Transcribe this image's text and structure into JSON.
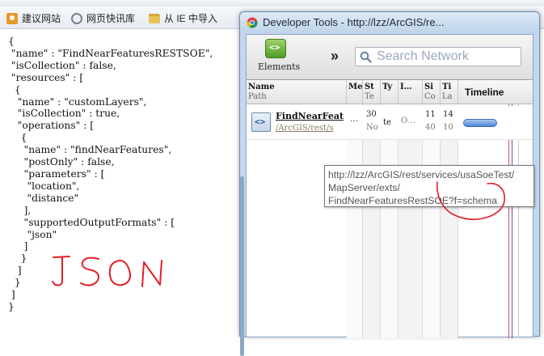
{
  "browser": {
    "bookmarks": [
      {
        "label": "建议网站",
        "icon": "bookmark-flag-icon"
      },
      {
        "label": "网页快讯库",
        "icon": "globe-icon"
      },
      {
        "label": "从 IE 中导入",
        "icon": "folder-icon"
      }
    ]
  },
  "page": {
    "json_lines": [
      "{",
      " \"name\" : \"FindNearFeaturesRESTSOE\",",
      " \"isCollection\" : false,",
      " \"resources\" : [",
      "  {",
      "   \"name\" : \"customLayers\",",
      "   \"isCollection\" : true,",
      "   \"operations\" : [",
      "    {",
      "     \"name\" : \"findNearFeatures\",",
      "     \"postOnly\" : false,",
      "     \"parameters\" : [",
      "      \"location\",",
      "      \"distance\"",
      "     ],",
      "     \"supportedOutputFormats\" : [",
      "      \"json\"",
      "     ]",
      "    }",
      "   ]",
      "  }",
      " ]",
      "}"
    ],
    "annotation": "JSON",
    "annotation_color": "#e0202a"
  },
  "devtools": {
    "title": "Developer Tools - http://lzz/ArcGIS/re...",
    "toolbar": {
      "elements_label": "Elements",
      "more_label": "»",
      "search_placeholder": "Search Network"
    },
    "network": {
      "columns": [
        {
          "h1": "Name",
          "h2": "Path"
        },
        {
          "h1": "Me",
          "h2": ""
        },
        {
          "h1": "St",
          "h2": "Te"
        },
        {
          "h1": "Ty",
          "h2": ""
        },
        {
          "h1": "I…",
          "h2": ""
        },
        {
          "h1": "Si",
          "h2": "Co"
        },
        {
          "h1": "Ti",
          "h2": "La"
        }
      ],
      "timeline_label": "Timeline",
      "rows": [
        {
          "name": "FindNearFeat",
          "path": "/ArcGIS/rest/s",
          "method": "…",
          "status": "30",
          "status_text": "No",
          "type": "te",
          "initiator": "O…",
          "size": "11",
          "content": "40",
          "time": "14",
          "latency": "10"
        }
      ]
    },
    "tooltip": [
      "http://lzz/ArcGIS/rest/services/usaSoeTest/",
      "MapServer/exts/",
      "FindNearFeaturesRestSOE?f=schema"
    ]
  }
}
